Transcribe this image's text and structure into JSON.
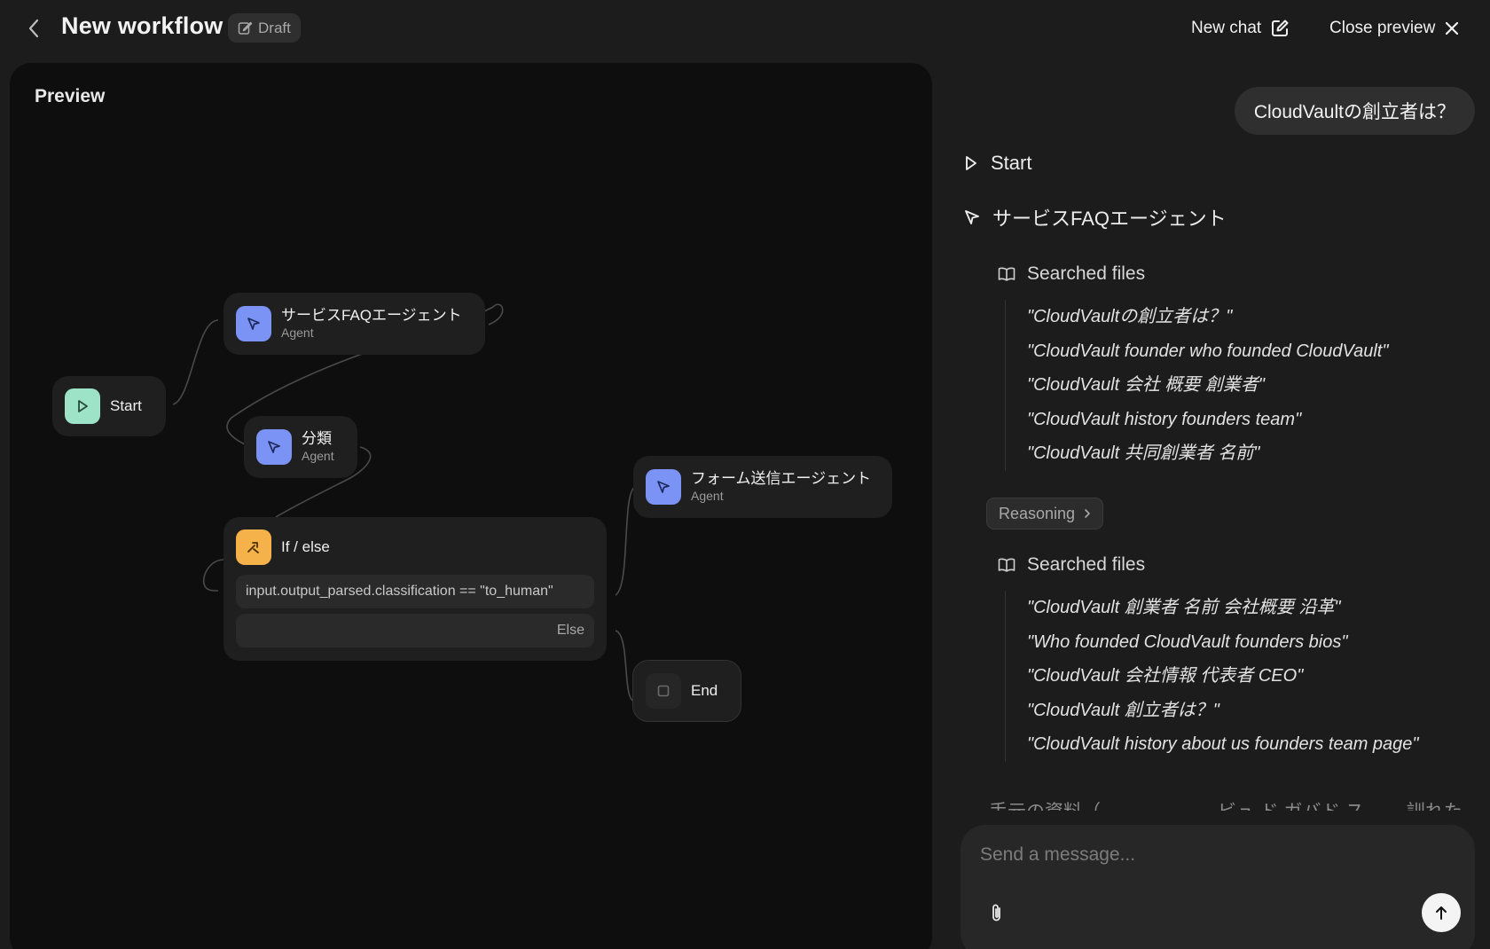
{
  "header": {
    "title": "New workflow",
    "badge": "Draft",
    "new_chat_label": "New chat",
    "close_preview_label": "Close preview"
  },
  "canvas": {
    "label": "Preview",
    "nodes": {
      "start": {
        "title": "Start"
      },
      "faq_agent": {
        "title": "サービスFAQエージェント",
        "subtitle": "Agent"
      },
      "classify": {
        "title": "分類",
        "subtitle": "Agent"
      },
      "form_agent": {
        "title": "フォーム送信エージェント",
        "subtitle": "Agent"
      },
      "ifelse": {
        "title": "If / else",
        "condition": "input.output_parsed.classification == \"to_human\"",
        "else_label": "Else"
      },
      "end": {
        "title": "End"
      }
    }
  },
  "chat": {
    "user_message": "CloudVaultの創立者は？",
    "steps": {
      "start": "Start",
      "agent": "サービスFAQエージェント"
    },
    "search_groups": [
      {
        "label": "Searched files",
        "queries": [
          "\"CloudVaultの創立者は？\"",
          "\"CloudVault founder who founded CloudVault\"",
          "\"CloudVault 会社 概要 創業者\"",
          "\"CloudVault history founders team\"",
          "\"CloudVault 共同創業者 名前\""
        ]
      },
      {
        "label": "Searched files",
        "queries": [
          "\"CloudVault 創業者 名前 会社概要 沿革\"",
          "\"Who founded CloudVault founders bios\"",
          "\"CloudVault 会社情報 代表者 CEO\"",
          "\"CloudVault 創立者は？\"",
          "\"CloudVault history about us founders team page\""
        ]
      }
    ],
    "reasoning_label": "Reasoning",
    "truncated_text": "手元の資料（……………… ビュ ド ガバド ス ……訓れた",
    "composer": {
      "placeholder": "Send a message..."
    }
  },
  "colors": {
    "agent_icon": "#7b93f5",
    "start_icon": "#9de3c8",
    "ifelse_icon": "#f6b24a",
    "canvas_bg": "#0e0e0e",
    "app_bg": "#1c1c1c"
  }
}
